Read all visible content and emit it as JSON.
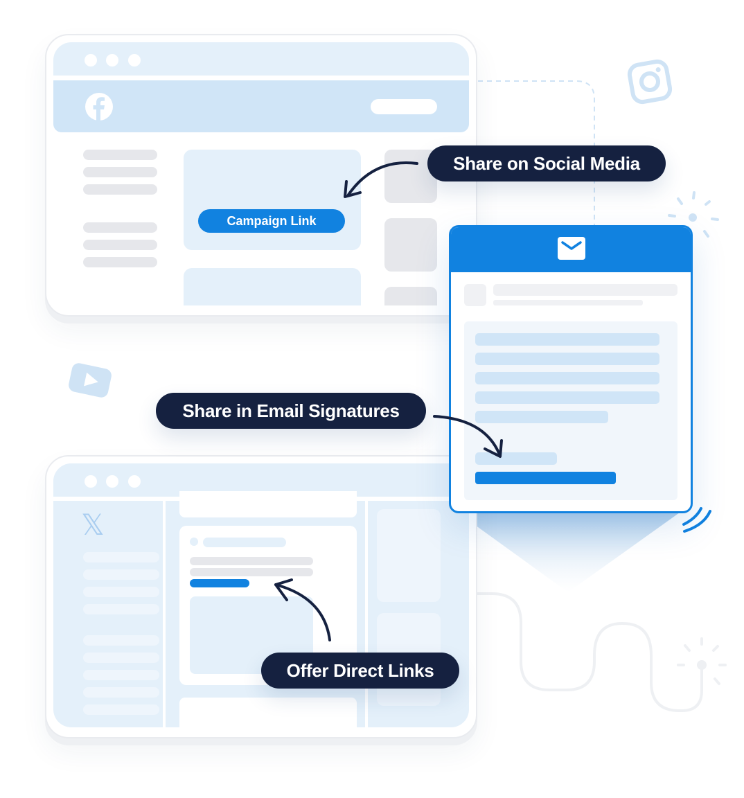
{
  "illustration": {
    "theme_colors": {
      "brand_blue": "#1182e0",
      "label_navy": "#152140",
      "pale_blue": "#e4f0fa",
      "mid_blue": "#d0e5f7",
      "placeholder_gray": "#e6e7eb"
    }
  },
  "facebook_window": {
    "logo_icon": "facebook-icon",
    "campaign_link_label": "Campaign Link"
  },
  "twitter_window": {
    "logo_icon": "x-icon",
    "logo_glyph": "𝕏"
  },
  "email_card": {
    "header_icon": "envelope-icon"
  },
  "labels": {
    "social": "Share on Social Media",
    "email": "Share in Email Signatures",
    "direct": "Offer Direct Links"
  },
  "decorations": {
    "instagram_icon": "instagram-icon",
    "youtube_icon": "youtube-icon"
  }
}
